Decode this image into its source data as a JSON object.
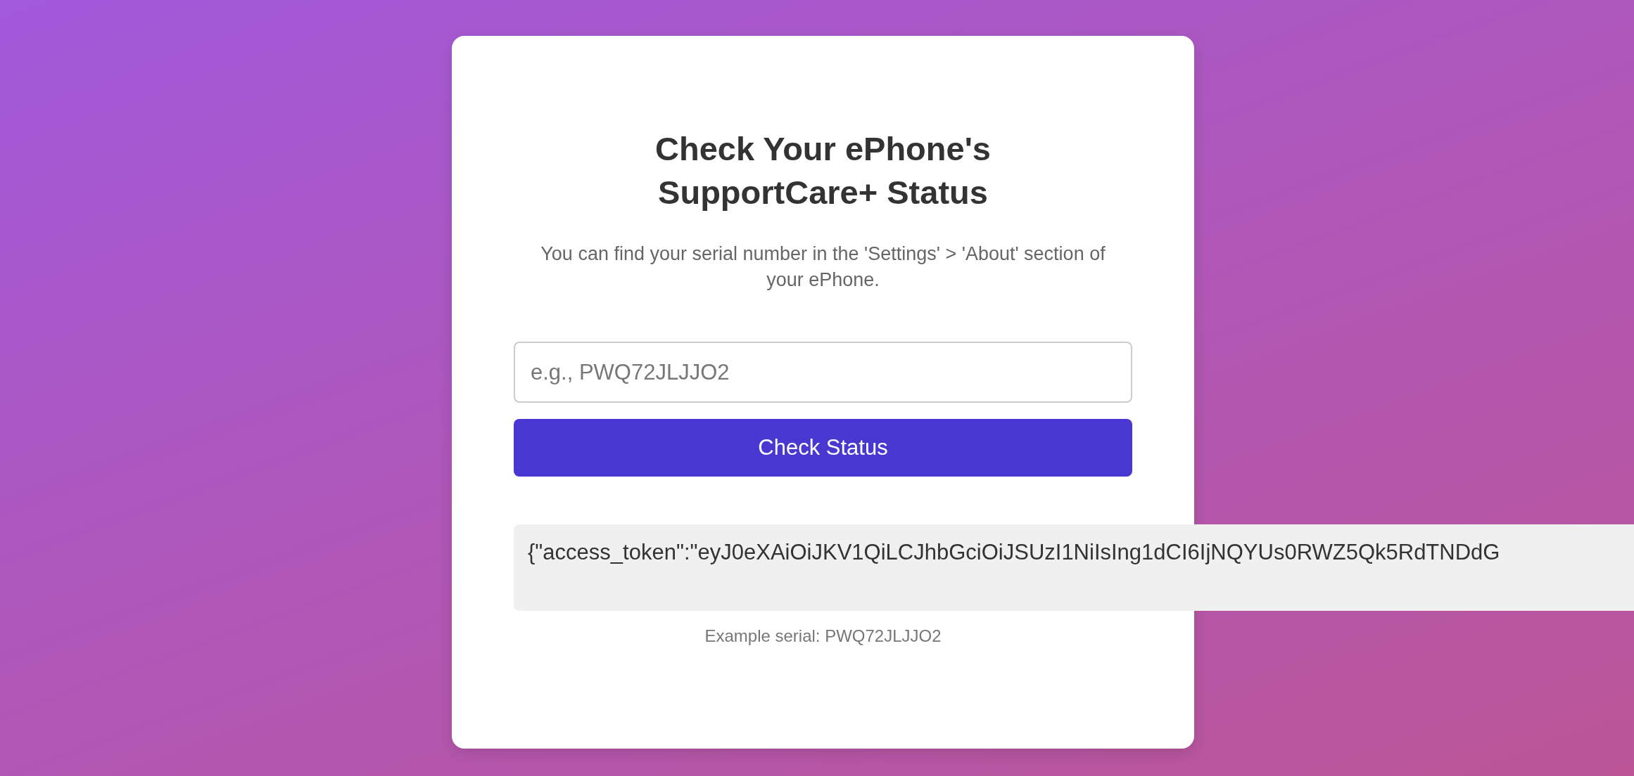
{
  "card": {
    "title": "Check Your ePhone's SupportCare+ Status",
    "subtitle": "You can find your serial number in the 'Settings' > 'About' section of your ePhone.",
    "serial_field": {
      "placeholder": "e.g., PWQ72JLJJO2"
    },
    "button": {
      "label": "Check Status"
    },
    "result": {
      "text": "{\"access_token\":\"eyJ0eXAiOiJKV1QiLCJhbGciOiJSUzI1NiIsIng1dCI6IjNQYUs0RWZ5Qk5RdTNDdG"
    },
    "example": "Example serial: PWQ72JLJJO2"
  }
}
